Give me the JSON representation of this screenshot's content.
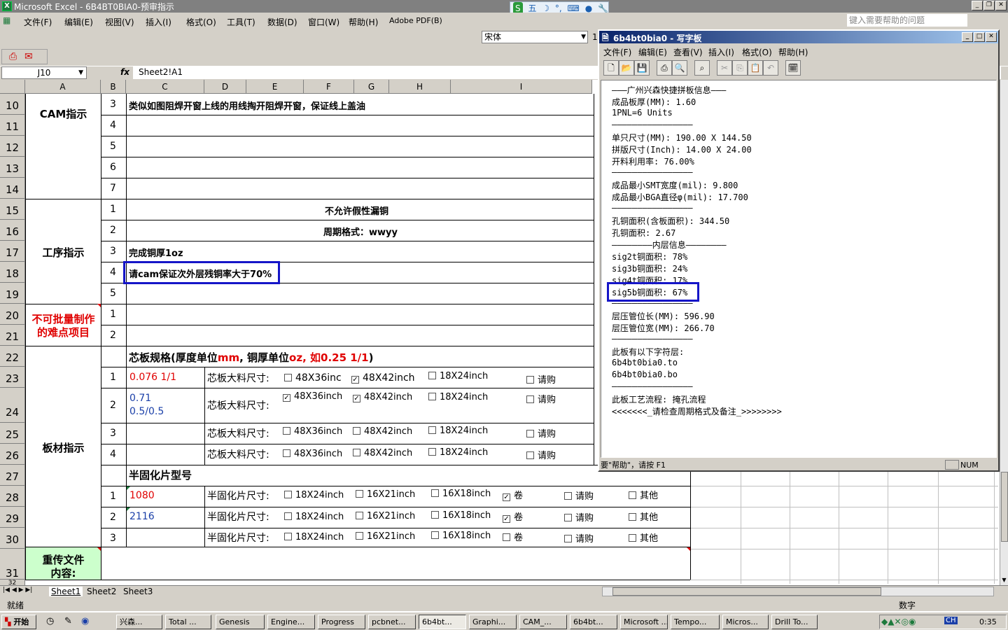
{
  "app": {
    "title": "Microsoft Excel - 6B4BT0BIA0-预审指示",
    "ime": [
      "五",
      "☽",
      "°,",
      "⌨",
      "●",
      "🔧"
    ],
    "menu": [
      "文件(F)",
      "编辑(E)",
      "视图(V)",
      "插入(I)",
      "格式(O)",
      "工具(T)",
      "数据(D)",
      "窗口(W)",
      "帮助(H)",
      "Adobe PDF(B)"
    ],
    "help_placeholder": "键入需要帮助的问题",
    "font_name": "宋体",
    "font_size": "1",
    "name_box": "J10",
    "fx": "fx",
    "formula": "Sheet2!A1"
  },
  "columns": [
    "A",
    "B",
    "C",
    "D",
    "E",
    "F",
    "G",
    "H",
    "I"
  ],
  "rows": [
    "10",
    "11",
    "12",
    "13",
    "14",
    "15",
    "16",
    "17",
    "18",
    "19",
    "20",
    "21",
    "22",
    "23",
    "24",
    "25",
    "26",
    "27",
    "28",
    "29",
    "30",
    "31",
    "32"
  ],
  "sheet": {
    "sections": {
      "cam": "CAM指示",
      "process": "工序指示",
      "difficult_line1": "不可批量制作",
      "difficult_line2": "的难点项目",
      "board": "板材指示",
      "reupload_line1": "重传文件",
      "reupload_line2": "内容:"
    },
    "numbers": [
      "3",
      "4",
      "5",
      "6",
      "7",
      "1",
      "2",
      "3",
      "4",
      "5",
      "1",
      "2",
      "1",
      "2",
      "3",
      "4",
      "1",
      "2",
      "3"
    ],
    "cam_note": "类似如图阻焊开窗上线的用线掏开阻焊开窗，保证线上盖油",
    "proc1": "不允许假性漏铜",
    "proc2": "周期格式：wwyy",
    "proc3": "完成铜厚1oz",
    "proc4": "请cam保证次外层残铜率大于70%",
    "core_header_a": "芯板规格(厚度单位",
    "core_header_b": "mm",
    "core_header_c": ", 铜厚单位",
    "core_header_d": "oz, 如0.25 1/1",
    "core_header_e": ")",
    "core1_spec": "0.076 1/1",
    "core2_spec_l1": "0.71",
    "core2_spec_l2": "0.5/0.5",
    "core_label": "芯板大料尺寸:",
    "core_opts": [
      "48X36inch",
      "48X42inch",
      "18X24inch",
      "请购"
    ],
    "core_opts_r1": [
      "48X36inc",
      "48X42inch",
      "18X24inch",
      "请购"
    ],
    "pp_header": "半固化片型号",
    "pp1": "1080",
    "pp2": "2116",
    "pp_label": "半固化片尺寸:",
    "pp_opts": [
      "18X24inch",
      "16X21inch",
      "16X18inch",
      "卷",
      "请购",
      "其他"
    ]
  },
  "checks": {
    "core1": [
      false,
      true,
      false,
      false
    ],
    "core2": [
      true,
      true,
      false,
      false
    ],
    "core3": [
      false,
      false,
      false,
      false
    ],
    "core4": [
      false,
      false,
      false,
      false
    ],
    "pp1": [
      false,
      false,
      false,
      true,
      false,
      false
    ],
    "pp2": [
      false,
      false,
      false,
      true,
      false,
      false
    ],
    "pp3": [
      false,
      false,
      false,
      false,
      false,
      false
    ]
  },
  "sheet_tabs": [
    "Sheet1",
    "Sheet2",
    "Sheet3"
  ],
  "status": {
    "left": "就绪",
    "right": "数字"
  },
  "wordpad": {
    "title": "6b4bt0bia0 - 写字板",
    "menu": [
      "文件(F)",
      "编辑(E)",
      "查看(V)",
      "插入(I)",
      "格式(O)",
      "帮助(H)"
    ],
    "lines": [
      "———广州兴森快捷拼板信息———",
      "成品板厚(MM): 1.60",
      "1PNL=6 Units",
      "————————————————",
      "单只尺寸(MM): 190.00 X 144.50",
      "拼版尺寸(Inch): 14.00 X 24.00",
      "开料利用率: 76.00%",
      "————————————————",
      "成品最小SMT宽度(mil): 9.800",
      "成品最小BGA直径φ(mil): 17.700",
      "————————————————",
      "孔铜面积(含板面积): 344.50",
      "孔铜面积: 2.67",
      "————————内层信息————————",
      "sig2t铜面积: 78%",
      "sig3b铜面积: 24%",
      "sig4t铜面积: 17%",
      "sig5b铜面积: 67%",
      "————————————————",
      "层压管位长(MM): 596.90",
      "层压管位宽(MM): 266.70",
      "————————————————",
      "此板有以下字符层:",
      "6b4bt0bia0.to",
      "6b4bt0bia0.bo",
      "————————————————",
      "此板工艺流程: 掩孔流程",
      "<<<<<<<_请检查周期格式及备注_>>>>>>>>"
    ],
    "status_help": "要\"帮助\"，请按 F1",
    "status_num": "NUM"
  },
  "taskbar": {
    "start": "开始",
    "items": [
      "兴森...",
      "Total ...",
      "Genesis",
      "Engine...",
      "Progress",
      "pcbnet...",
      "6b4bt...",
      "Graphi...",
      "CAM_...",
      "6b4bt...",
      "Microsoft ...",
      "Tempo...",
      "Micros...",
      "Drill To..."
    ],
    "clock": "0:35",
    "lang": "CH"
  },
  "colors": {
    "accent_red": "#e00000",
    "accent_blue": "#1a3fa8",
    "highlight": "#1515c8",
    "reupload_bg": "#ccffcc"
  }
}
